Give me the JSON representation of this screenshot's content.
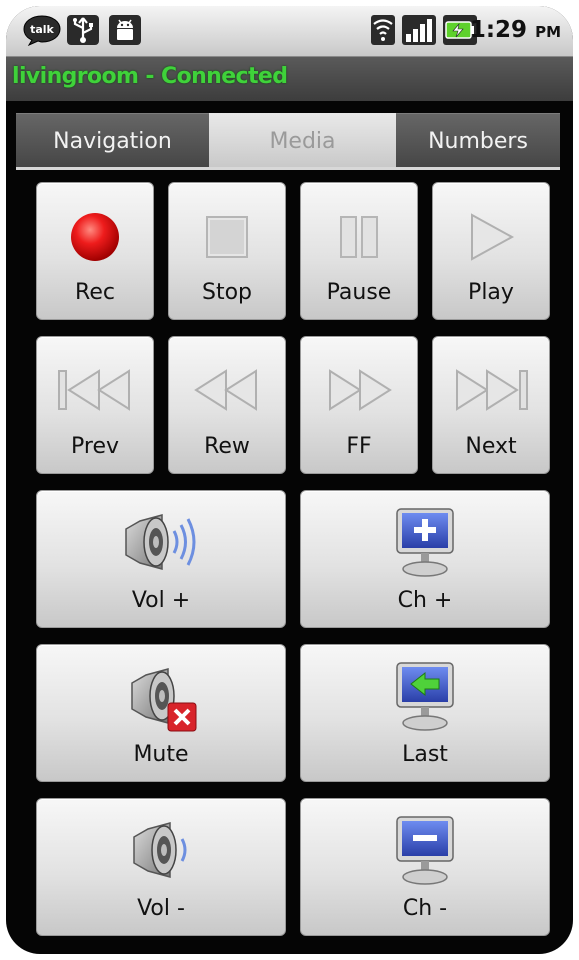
{
  "status_bar": {
    "icons": [
      "talk-icon",
      "usb-icon",
      "android-debug-icon",
      "wifi-icon",
      "signal-icon",
      "battery-charging-icon"
    ],
    "talk_text": "talk",
    "time": "1:29",
    "ampm": "PM"
  },
  "title_bar": {
    "text": "livingroom - Connected",
    "color": "#3fd23a"
  },
  "tabs": [
    {
      "label": "Navigation",
      "selected": false
    },
    {
      "label": "Media",
      "selected": true
    },
    {
      "label": "Numbers",
      "selected": false
    }
  ],
  "buttons": {
    "rec": {
      "label": "Rec",
      "icon": "record-icon"
    },
    "stop": {
      "label": "Stop",
      "icon": "stop-icon"
    },
    "pause": {
      "label": "Pause",
      "icon": "pause-icon"
    },
    "play": {
      "label": "Play",
      "icon": "play-icon"
    },
    "prev": {
      "label": "Prev",
      "icon": "skip-previous-icon"
    },
    "rew": {
      "label": "Rew",
      "icon": "rewind-icon"
    },
    "ff": {
      "label": "FF",
      "icon": "fast-forward-icon"
    },
    "next": {
      "label": "Next",
      "icon": "skip-next-icon"
    },
    "vol_up": {
      "label": "Vol +",
      "icon": "speaker-volume-up-icon"
    },
    "ch_up": {
      "label": "Ch +",
      "icon": "monitor-plus-icon"
    },
    "mute": {
      "label": "Mute",
      "icon": "speaker-mute-icon"
    },
    "last": {
      "label": "Last",
      "icon": "monitor-back-arrow-icon"
    },
    "vol_down": {
      "label": "Vol -",
      "icon": "speaker-volume-down-icon"
    },
    "ch_down": {
      "label": "Ch -",
      "icon": "monitor-minus-icon"
    }
  },
  "colors": {
    "record_red": "#e01010",
    "accent_green": "#3fd23a",
    "mute_red": "#d8232a",
    "screen_blue": "#3b55c8"
  }
}
